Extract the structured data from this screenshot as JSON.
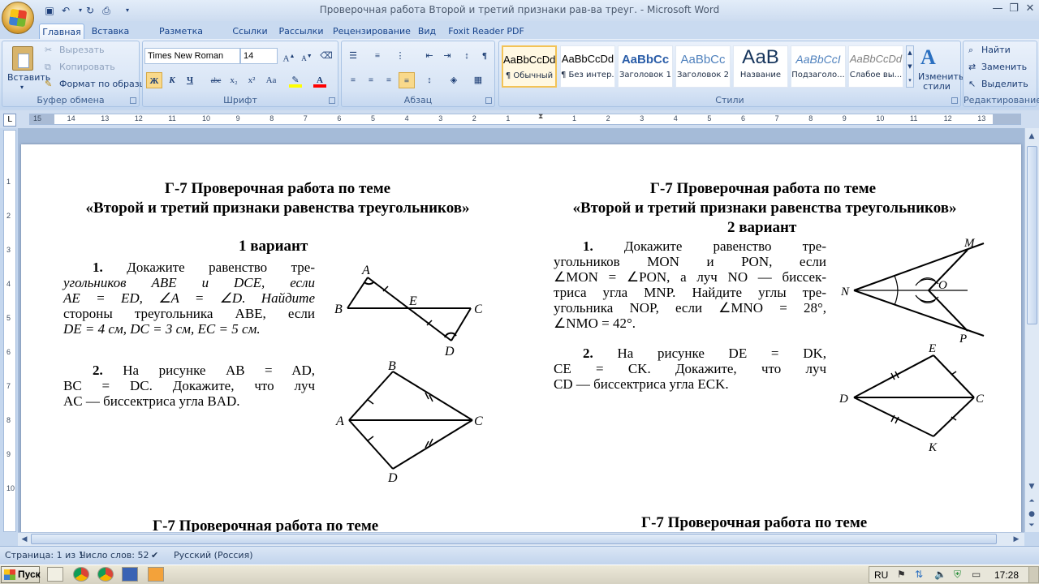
{
  "window": {
    "title": "Проверочная работа Второй и третий признаки рав-ва треуг. - Microsoft Word",
    "controls": [
      "—",
      "❐",
      "✕"
    ]
  },
  "quick_access": [
    "save-icon",
    "undo-icon",
    "redo-icon",
    "print-preview-icon",
    "customize-icon"
  ],
  "tabs": [
    "Главная",
    "Вставка",
    "Разметка страницы",
    "Ссылки",
    "Рассылки",
    "Рецензирование",
    "Вид",
    "Foxit Reader PDF"
  ],
  "active_tab": "Главная",
  "ribbon": {
    "clipboard": {
      "label": "Буфер обмена",
      "paste": "Вставить",
      "cut": "Вырезать",
      "copy": "Копировать",
      "format_painter": "Формат по образцу"
    },
    "font": {
      "label": "Шрифт",
      "family": "Times New Roman",
      "size": "14",
      "grow": "A",
      "shrink": "A",
      "bold": "Ж",
      "italic": "К",
      "underline": "Ч",
      "strike": "abc",
      "subscript": "x₂",
      "superscript": "x²",
      "case": "Aa",
      "font_color": "A",
      "highlight_color": "#ffff00",
      "font_color_value": "#ff0000"
    },
    "paragraph": {
      "label": "Абзац",
      "pilcrow": "¶"
    },
    "styles": {
      "label": "Стили",
      "items": [
        {
          "sample": "AaBbCcDd",
          "name": "¶ Обычный"
        },
        {
          "sample": "AaBbCcDd",
          "name": "¶ Без интер..."
        },
        {
          "sample": "AaBbCc",
          "name": "Заголовок 1"
        },
        {
          "sample": "AaBbCc",
          "name": "Заголовок 2"
        },
        {
          "sample": "АаВ",
          "name": "Название"
        },
        {
          "sample": "AaBbCcI",
          "name": "Подзаголо..."
        },
        {
          "sample": "AaBbCcDd",
          "name": "Слабое вы..."
        }
      ],
      "change": "Изменить стили"
    },
    "editing": {
      "label": "Редактирование",
      "find": "Найти",
      "replace": "Заменить",
      "select": "Выделить"
    }
  },
  "ruler": {
    "tab_selector": "L",
    "left_numbers": [
      "15",
      "14",
      "13",
      "12",
      "11",
      "10",
      "9",
      "8",
      "7",
      "6",
      "5",
      "4",
      "3",
      "2",
      "1"
    ],
    "right_numbers": [
      "1",
      "2",
      "3",
      "4",
      "5",
      "6",
      "7",
      "8",
      "9",
      "10",
      "11",
      "12",
      "13",
      "14"
    ]
  },
  "vertical_ruler": [
    "1",
    "2",
    "3",
    "4",
    "5",
    "6",
    "7",
    "8",
    "9",
    "10"
  ],
  "document": {
    "left": {
      "title1": "Г-7 Проверочная работа по теме",
      "title2": "«Второй и третий признаки равенства треугольников»",
      "variant": "1 вариант",
      "task1_num": "1.",
      "task1_lines": [
        "Докажите равенство тре-",
        "угольников ABE и DCE, если",
        "AE = ED,  ∠A = ∠D.  Найдите",
        "стороны треугольника ABE, если",
        "DE = 4 см, DC = 3 см, EC = 5 см."
      ],
      "task2_num": "2.",
      "task2_lines": [
        "На рисунке AB = AD,",
        "BC = DC. Докажите, что луч",
        "AC — биссектриса угла BAD."
      ],
      "fig1_labels": [
        "A",
        "B",
        "E",
        "C",
        "D"
      ],
      "fig2_labels": [
        "B",
        "A",
        "C",
        "D"
      ],
      "bottom_title": "Г-7 Проверочная работа по теме"
    },
    "right": {
      "title1": "Г-7 Проверочная работа по теме",
      "title2": "«Второй и третий признаки равенства треугольников»",
      "variant": "2 вариант",
      "task1_num": "1.",
      "task1_lines": [
        "Докажите равенство тре-",
        "угольников MON и PON, если",
        "∠MON = ∠PON, а луч NO — биссек-",
        "триса угла MNP. Найдите углы тре-",
        "угольника NOP, если ∠MNO = 28°,",
        "∠NMO = 42°."
      ],
      "task2_num": "2.",
      "task2_lines": [
        "На рисунке DE = DK,",
        "CE = CK. Докажите, что луч",
        "CD — биссектриса угла ECK."
      ],
      "fig1_labels": [
        "M",
        "N",
        "O",
        "P"
      ],
      "fig2_labels": [
        "E",
        "D",
        "C",
        "K"
      ],
      "bottom_title": "Г-7 Проверочная работа по теме"
    }
  },
  "status": {
    "page": "Страница: 1 из 1",
    "words": "Число слов: 52",
    "language": "Русский (Россия)"
  },
  "taskbar": {
    "start": "Пуск",
    "lang": "RU",
    "time": "17:28"
  }
}
